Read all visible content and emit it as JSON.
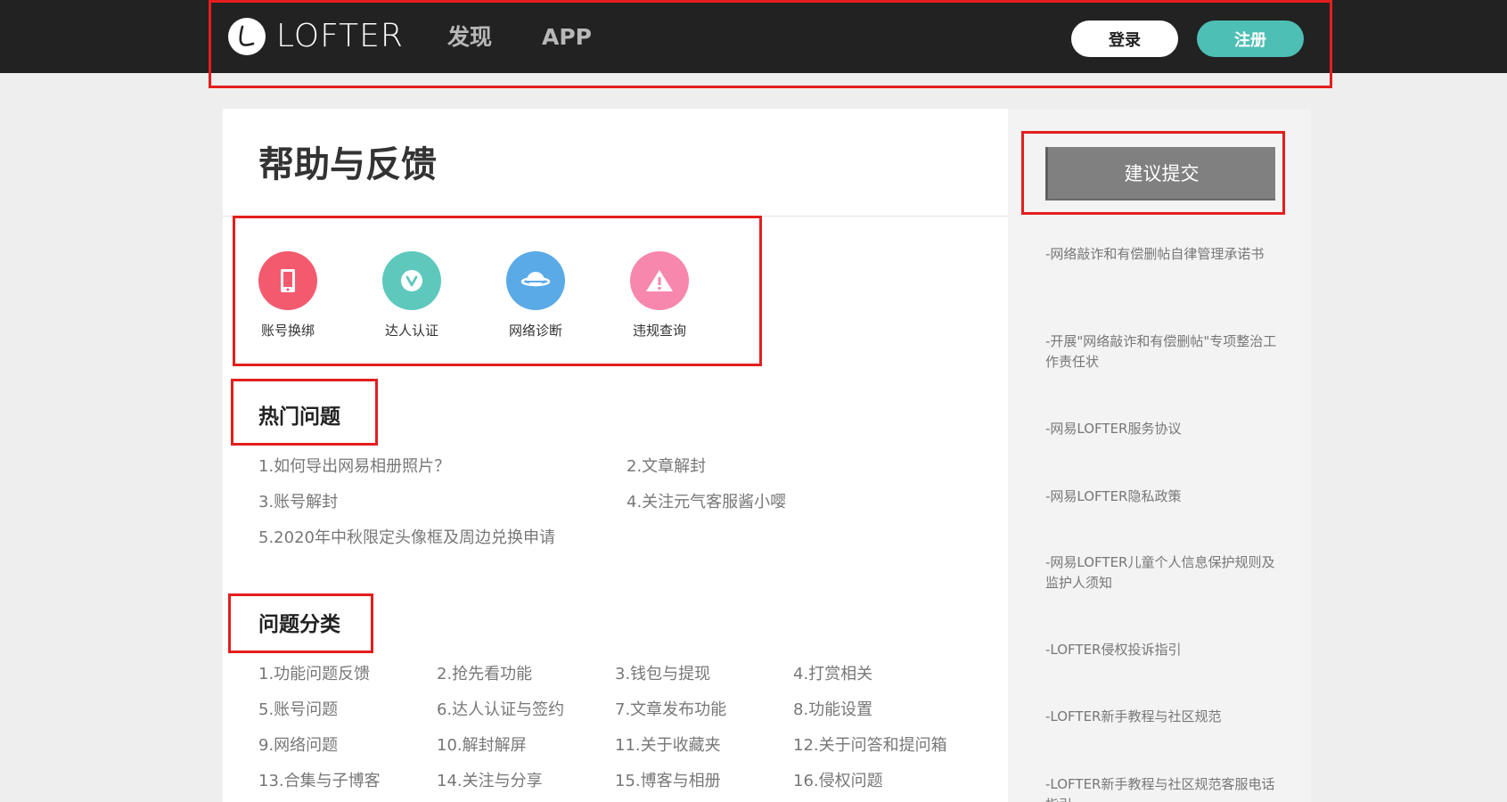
{
  "header": {
    "logo_text": "LOFTER",
    "nav": [
      "发现",
      "APP"
    ],
    "login_label": "登录",
    "register_label": "注册"
  },
  "main": {
    "title": "帮助与反馈",
    "quick_links": [
      {
        "label": "账号换绑",
        "icon": "tablet-icon",
        "color": "#f45a6e"
      },
      {
        "label": "达人认证",
        "icon": "verified-v-icon",
        "color": "#5ec8bd"
      },
      {
        "label": "网络诊断",
        "icon": "planet-icon",
        "color": "#5aaae8"
      },
      {
        "label": "违规查询",
        "icon": "warning-icon",
        "color": "#f787ad"
      }
    ],
    "hot_title": "热门问题",
    "hot_items": [
      "1.如何导出网易相册照片？",
      "2.文章解封",
      "3.账号解封",
      "4.关注元气客服酱小嘤",
      "5.2020年中秋限定头像框及周边兑换申请"
    ],
    "category_title": "问题分类",
    "categories": [
      "1.功能问题反馈",
      "2.抢先看功能",
      "3.钱包与提现",
      "4.打赏相关",
      "5.账号问题",
      "6.达人认证与签约",
      "7.文章发布功能",
      "8.功能设置",
      "9.网络问题",
      "10.解封解屏",
      "11.关于收藏夹",
      "12.关于问答和提问箱",
      "13.合集与子博客",
      "14.关注与分享",
      "15.博客与相册",
      "16.侵权问题"
    ]
  },
  "sidebar": {
    "suggest_label": "建议提交",
    "links": [
      "-网络敲诈和有偿删帖自律管理承诺书",
      "-开展\"网络敲诈和有偿删帖\"专项整治工作责任状",
      "-网易LOFTER服务协议",
      "-网易LOFTER隐私政策",
      "-网易LOFTER儿童个人信息保护规则及监护人须知",
      "-LOFTER侵权投诉指引",
      "-LOFTER新手教程与社区规范",
      "-LOFTER新手教程与社区规范客服电话指引"
    ]
  },
  "colors": {
    "header_bg": "#222222",
    "register_accent": "#4ebfb5",
    "annotation_red": "#e41e1e"
  }
}
